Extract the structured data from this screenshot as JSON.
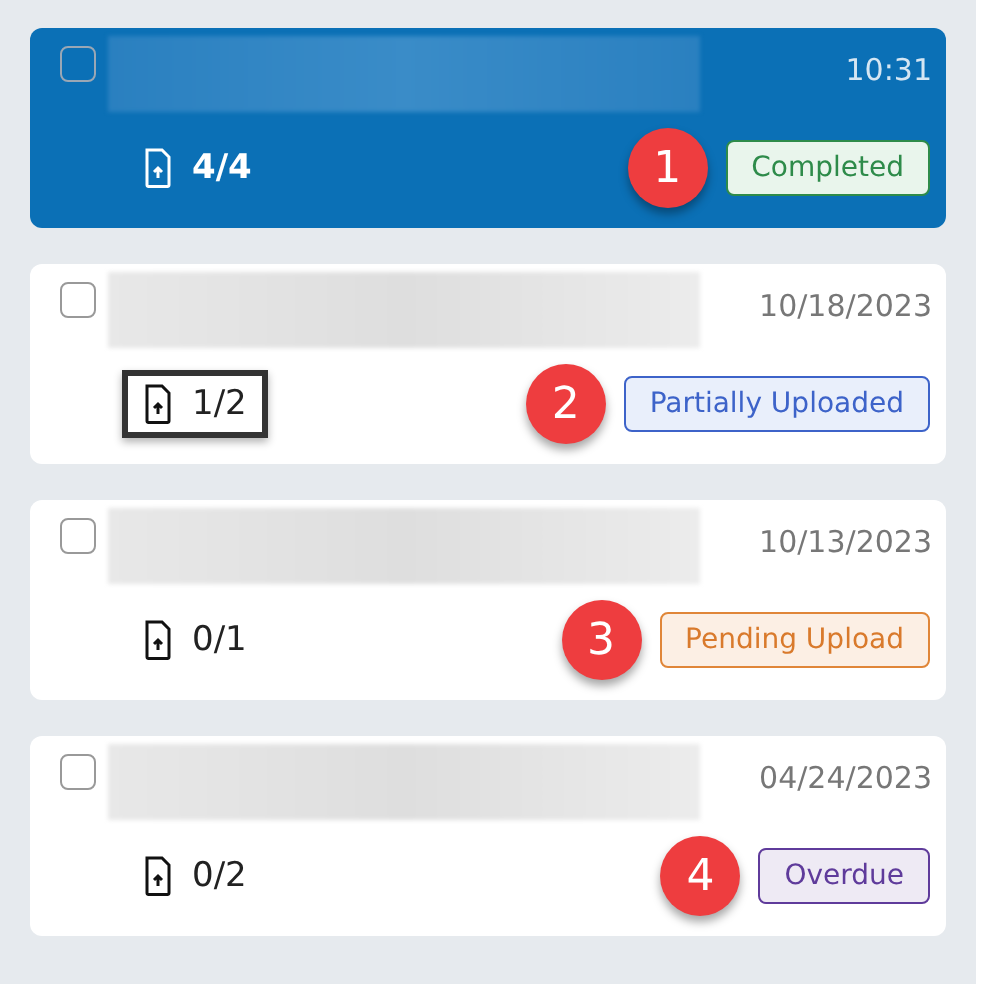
{
  "cards": [
    {
      "selected": true,
      "checked": false,
      "time": "10:31",
      "count": "4/4",
      "highlighted": false,
      "status": {
        "label": "Completed",
        "kind": "completed"
      },
      "callout": "1"
    },
    {
      "selected": false,
      "checked": false,
      "time": "10/18/2023",
      "count": "1/2",
      "highlighted": true,
      "status": {
        "label": "Partially Uploaded",
        "kind": "partial"
      },
      "callout": "2"
    },
    {
      "selected": false,
      "checked": false,
      "time": "10/13/2023",
      "count": "0/1",
      "highlighted": false,
      "status": {
        "label": "Pending Upload",
        "kind": "pending"
      },
      "callout": "3"
    },
    {
      "selected": false,
      "checked": false,
      "time": "04/24/2023",
      "count": "0/2",
      "highlighted": false,
      "status": {
        "label": "Overdue",
        "kind": "overdue"
      },
      "callout": "4"
    }
  ]
}
